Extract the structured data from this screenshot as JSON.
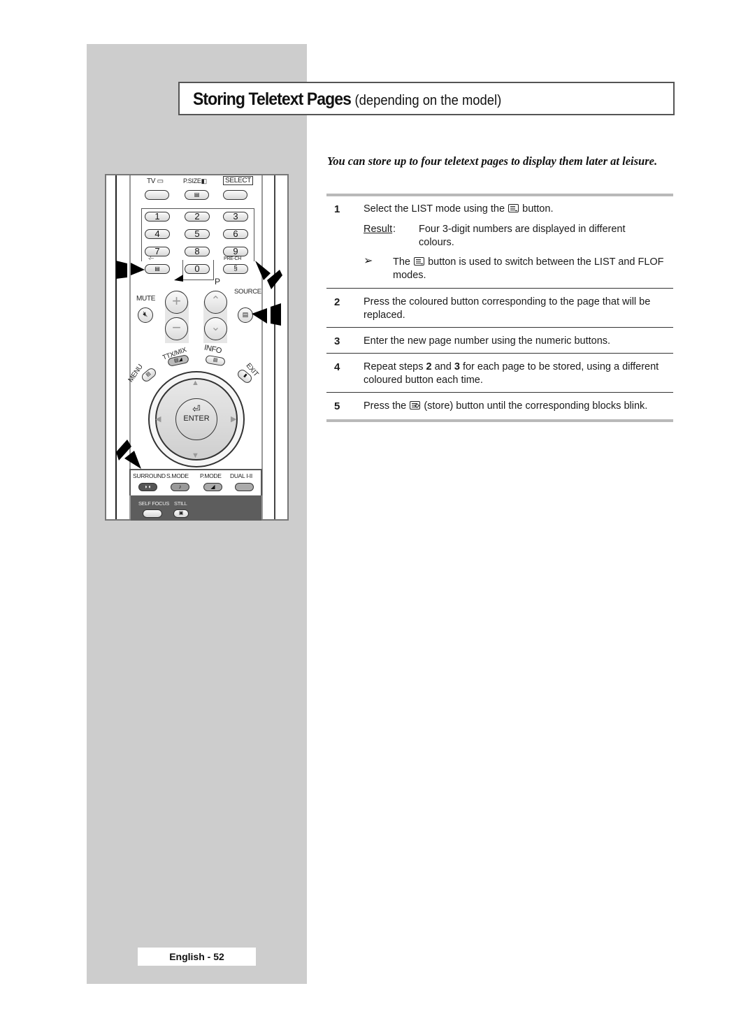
{
  "header": {
    "title": "Storing Teletext Pages",
    "subtitle": "(depending on the model)"
  },
  "intro": "You can store up to four teletext pages to display them later at leisure.",
  "steps": [
    {
      "number": "1",
      "text_before": "Select the LIST mode using the",
      "icon": "list-button-icon",
      "text_after": "button.",
      "result_label": "Result",
      "result_text": "Four 3-digit numbers are displayed in different colours.",
      "note_icon": "arrow-note-icon",
      "note_glyph": "➢",
      "note_before": "The",
      "note_icon_button": "list-button-icon",
      "note_after": "button is used to switch between the LIST and FLOF modes."
    },
    {
      "number": "2",
      "text": "Press the coloured button corresponding to the page that will be replaced."
    },
    {
      "number": "3",
      "text": "Enter the new page number using the numeric buttons."
    },
    {
      "number": "4",
      "text_before": "Repeat steps",
      "bold1": "2",
      "text_mid": "and",
      "bold2": "3",
      "text_after": "for each page to be stored, using a different coloured button each time."
    },
    {
      "number": "5",
      "text_before": "Press the",
      "icon": "store-button-icon",
      "text_after": "(store) button until the corresponding blocks blink."
    }
  ],
  "remote": {
    "top_labels": {
      "tv": "TV",
      "psize": "P.SIZE",
      "select": "SELECT"
    },
    "digits": [
      "1",
      "2",
      "3",
      "4",
      "5",
      "6",
      "7",
      "8",
      "9",
      "0"
    ],
    "dash_label": "-/--",
    "prech_label": "PRE-CH",
    "p_label": "P",
    "mute_label": "MUTE",
    "source_label": "SOURCE",
    "ttx_label": "TTX/MIX",
    "info_label": "INFO",
    "menu_label": "MENU",
    "exit_label": "EXIT",
    "enter_label": "ENTER",
    "bottom_labels": [
      "SURROUND",
      "S.MODE",
      "P.MODE",
      "DUAL I-II"
    ],
    "lower_labels": [
      "SELF FOCUS",
      "STILL"
    ],
    "plus": "+",
    "minus": "−",
    "up": "▲",
    "down": "▼",
    "left": "◀",
    "right": "▶"
  },
  "footer": {
    "page_label": "English - 52"
  }
}
